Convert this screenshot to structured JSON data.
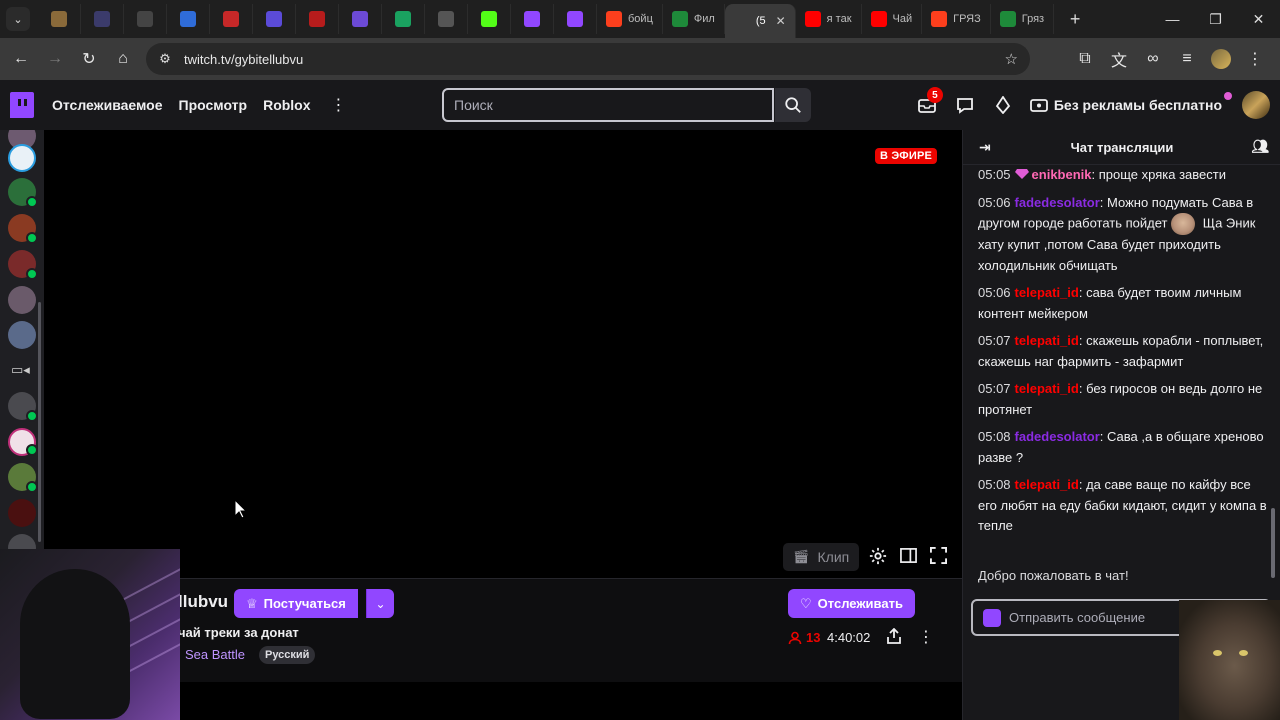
{
  "browser": {
    "tabs": [
      {
        "title": "",
        "icon": "cat-icon",
        "color": "#8a6a3a"
      },
      {
        "title": "",
        "icon": "app-icon",
        "color": "#3b3b6b"
      },
      {
        "title": "",
        "icon": "p-icon",
        "color": "#444"
      },
      {
        "title": "",
        "icon": "globe-icon",
        "color": "#2f6cd8"
      },
      {
        "title": "",
        "icon": "mask-icon",
        "color": "#c62828"
      },
      {
        "title": "",
        "icon": "stripes-icon",
        "color": "#5b4bd8"
      },
      {
        "title": "",
        "icon": "red-square-icon",
        "color": "#b71c1c"
      },
      {
        "title": "",
        "icon": "ya-icon",
        "color": "#6c4ad6"
      },
      {
        "title": "",
        "icon": "plus-icon",
        "color": "#1aa260"
      },
      {
        "title": "",
        "icon": "hd-icon",
        "color": "#555"
      },
      {
        "title": "",
        "icon": "k-icon",
        "color": "#53fc18"
      },
      {
        "title": "",
        "icon": "twitch-icon",
        "color": "#9147ff"
      },
      {
        "title": "",
        "icon": "twitch-icon",
        "color": "#9147ff"
      },
      {
        "title": "бойц",
        "icon": "yandex-icon",
        "color": "#fc3f1d"
      },
      {
        "title": "Фил",
        "icon": "hd-icon",
        "color": "#1e8a3a"
      },
      {
        "title": "(5",
        "icon": "speaker-icon",
        "color": "#3a3a3a",
        "active": true
      },
      {
        "title": "я так",
        "icon": "youtube-icon",
        "color": "#ff0000"
      },
      {
        "title": "Чай",
        "icon": "youtube-icon",
        "color": "#ff0000"
      },
      {
        "title": "ГРЯЗ",
        "icon": "yandex-icon",
        "color": "#fc3f1d"
      },
      {
        "title": "Гряз",
        "icon": "hd-icon",
        "color": "#1e8a3a"
      }
    ],
    "url": "twitch.tv/gybitellubvu"
  },
  "nav": {
    "links": [
      "Отслеживаемое",
      "Просмотр",
      "Roblox"
    ],
    "search_placeholder": "Поиск",
    "notif_count": "5",
    "adfree_label": "Без рекламы бесплатно"
  },
  "player": {
    "live_label": "В ЭФИРЕ",
    "clip_label": "Клип"
  },
  "channel": {
    "name_partial": "llubvu",
    "subscribe_label": "Постучаться",
    "follow_label": "Отслеживать",
    "title_partial": "чай треки за донат",
    "game": "Sea Battle",
    "tag": "Русский",
    "viewers": "13",
    "uptime": "4:40:02"
  },
  "chat": {
    "header": "Чат трансляции",
    "messages": [
      {
        "time": "05:05",
        "user": "enikbenik",
        "color": "#ff69b4",
        "text": ": проще хряка завести",
        "gem": true
      },
      {
        "time": "05:06",
        "user": "fadedesolator",
        "color": "#8a2be2",
        "text": ": Можно подумать Сава в другом городе работать пойдет",
        "emote": true,
        "text2": " Ща Эник хату купит ,потом Сава будет приходить холодильник обчищать"
      },
      {
        "time": "05:06",
        "user": "telepati_id",
        "color": "#ff0000",
        "text": ": сава будет твоим личным контент мейкером"
      },
      {
        "time": "05:07",
        "user": "telepati_id",
        "color": "#ff0000",
        "text": ": скажешь корабли - поплывет, скажешь наг фармить - зафармит"
      },
      {
        "time": "05:07",
        "user": "telepati_id",
        "color": "#ff0000",
        "text": ": без гиросов он ведь долго не протянет"
      },
      {
        "time": "05:08",
        "user": "fadedesolator",
        "color": "#8a2be2",
        "text": ": Сава ,а в общаге хреново разве ?"
      },
      {
        "time": "05:08",
        "user": "telepati_id",
        "color": "#ff0000",
        "text": ": да саве ваще по кайфу все его любят на еду бабки кидают, сидит у компа в тепле"
      }
    ],
    "welcome": "Добро пожаловать в чат!",
    "input_placeholder": "Отправить сообщение"
  },
  "colors": {
    "accent": "#9147ff",
    "live": "#eb0400"
  }
}
